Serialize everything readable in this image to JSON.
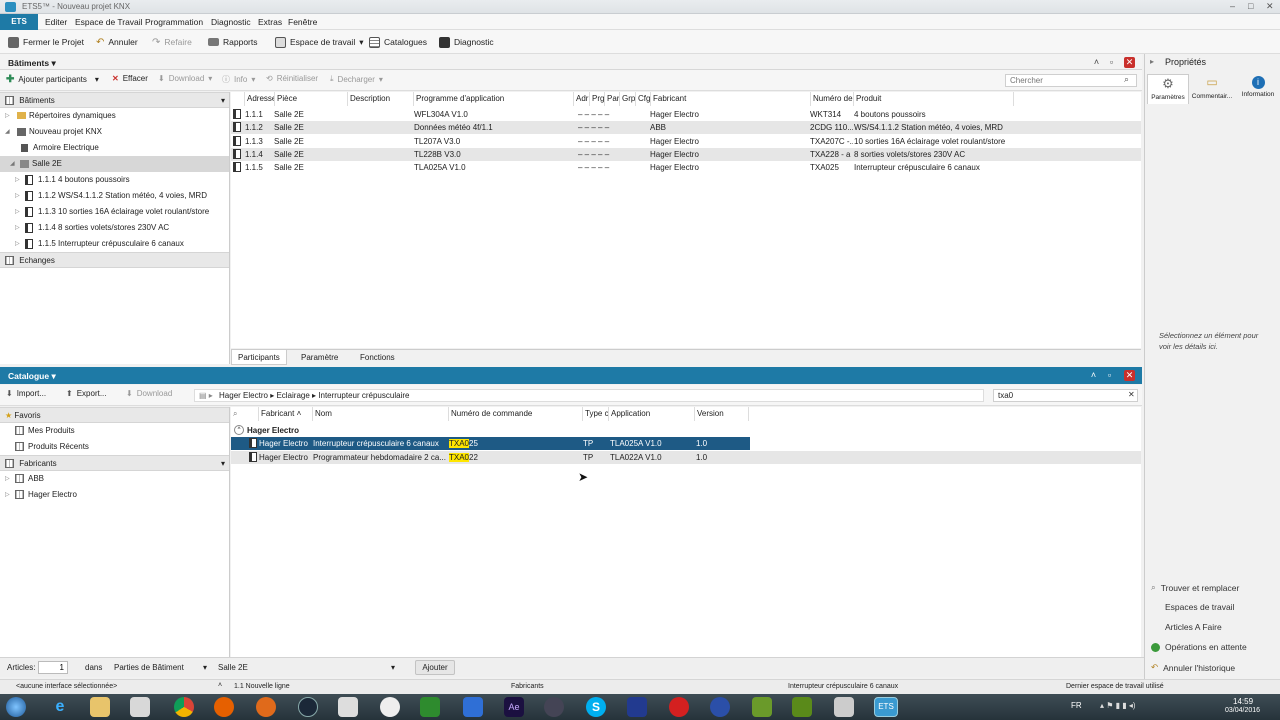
{
  "window": {
    "title": "ETS5™ - Nouveau projet KNX"
  },
  "menu": {
    "app_button": "ETS",
    "items": [
      "Editer",
      "Espace de Travail",
      "Programmation",
      "Diagnostic",
      "Extras",
      "Fenêtre"
    ]
  },
  "toolbar": {
    "close_project": "Fermer le Projet",
    "undo": "Annuler",
    "redo": "Refaire",
    "reports": "Rapports",
    "workspace": "Espace de travail",
    "catalogs": "Catalogues",
    "diagnostic": "Diagnostic"
  },
  "buildings": {
    "title": "Bâtiments",
    "add_participants": "Ajouter participants",
    "delete": "Effacer",
    "download": "Download",
    "info": "Info",
    "reset": "Réinitialiser",
    "unload": "Decharger",
    "search_placeholder": "Chercher",
    "tree": {
      "header": "Bâtiments",
      "dynamic_folders": "Répertoires dynamiques",
      "project": "Nouveau projet KNX",
      "cabinet": "Armoire Electrique",
      "room": "Salle 2E",
      "devices": [
        "1.1.1 4 boutons poussoirs",
        "1.1.2 WS/S4.1.1.2 Station météo, 4 voies, MRD",
        "1.1.3 10 sorties 16A éclairage volet roulant/store",
        "1.1.4 8 sorties volets/stores 230V AC",
        "1.1.5 Interrupteur crépusculaire 6 canaux"
      ],
      "exchanges": "Echanges"
    },
    "columns": [
      "Adresse",
      "Pièce",
      "Description",
      "Programme d'application",
      "Adr",
      "Prg",
      "Par",
      "Grp",
      "Cfg",
      "Fabricant",
      "Numéro de",
      "Produit"
    ],
    "rows": [
      {
        "addr": "1.1.1",
        "room": "Salle 2E",
        "desc": "",
        "app": "WFL304A V1.0",
        "flags": "–   –   –   –   –",
        "maker": "Hager Electro",
        "order": "WKT314",
        "product": "4 boutons poussoirs"
      },
      {
        "addr": "1.1.2",
        "room": "Salle 2E",
        "desc": "",
        "app": "Données météo 4f/1.1",
        "flags": "–   –   –   –   –",
        "maker": "ABB",
        "order": "2CDG 110...",
        "product": "WS/S4.1.1.2 Station météo, 4 voies, MRD"
      },
      {
        "addr": "1.1.3",
        "room": "Salle 2E",
        "desc": "",
        "app": "TL207A V3.0",
        "flags": "–   –   –   –   –",
        "maker": "Hager Electro",
        "order": "TXA207C -...",
        "product": "10 sorties 16A éclairage volet roulant/store"
      },
      {
        "addr": "1.1.4",
        "room": "Salle 2E",
        "desc": "",
        "app": "TL228B V3.0",
        "flags": "–   –   –   –   –",
        "maker": "Hager Electro",
        "order": "TXA228 - a",
        "product": "8 sorties volets/stores 230V AC"
      },
      {
        "addr": "1.1.5",
        "room": "Salle 2E",
        "desc": "",
        "app": "TLA025A V1.0",
        "flags": "–   –   –   –   –",
        "maker": "Hager Electro",
        "order": "TXA025",
        "product": "Interrupteur crépusculaire 6 canaux"
      }
    ],
    "tabs": [
      "Participants",
      "Paramètre",
      "Fonctions"
    ]
  },
  "catalog": {
    "title": "Catalogue",
    "import": "Import...",
    "export": "Export...",
    "download": "Download",
    "breadcrumb": [
      "Hager Electro",
      "Eclairage",
      "Interrupteur crépusculaire"
    ],
    "search_value": "txa0",
    "favorites": "Favoris",
    "my_products": "Mes Produits",
    "recent_products": "Produits Récents",
    "manufacturers": "Fabricants",
    "maker_list": [
      "ABB",
      "Hager Electro"
    ],
    "columns": [
      "Fabricant",
      "Nom",
      "Numéro de commande",
      "Type c",
      "Application",
      "Version"
    ],
    "group": "Hager Electro",
    "rows": [
      {
        "maker": "Hager Electro",
        "name": "Interrupteur crépusculaire 6 canaux",
        "order_hl": "TXA0",
        "order_rest": "25",
        "type": "TP",
        "app": "TLA025A V1.0",
        "version": "1.0"
      },
      {
        "maker": "Hager Electro",
        "name": "Programmateur hebdomadaire 2 ca...",
        "order_hl": "TXA0",
        "order_rest": "22",
        "type": "TP",
        "app": "TLA022A V1.0",
        "version": "1.0"
      }
    ],
    "footer": {
      "articles_label": "Articles:",
      "articles_value": "1",
      "in_label": "dans",
      "building_parts": "Parties de Bâtiment",
      "room": "Salle 2E",
      "add_button": "Ajouter"
    }
  },
  "properties": {
    "title": "Propriétés",
    "tabs": [
      "Paramètres",
      "Commentair...",
      "Information"
    ],
    "empty_text": "Sélectionnez un élément pour voir les détails ici.",
    "actions": [
      "Trouver et remplacer",
      "Espaces de travail",
      "Articles A Faire",
      "Opérations en attente",
      "Annuler l'historique"
    ]
  },
  "status": {
    "interface": "<aucune interface sélectionnée>",
    "line": "1.1 Nouvelle ligne",
    "maker": "Fabricants",
    "product": "Interrupteur crépusculaire 6 canaux",
    "workspace": "Dernier espace de travail utilisé"
  },
  "taskbar": {
    "lang": "FR",
    "time": "14:59",
    "date": "03/04/2016",
    "ets_label": "ETS"
  }
}
